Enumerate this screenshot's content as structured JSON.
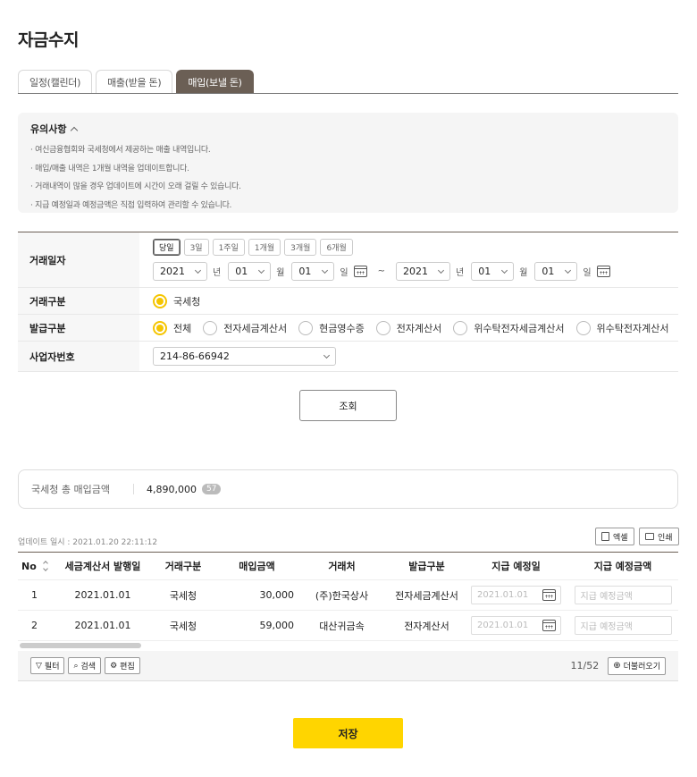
{
  "page_title": "자금수지",
  "tabs": [
    {
      "label": "일정(캘린더)"
    },
    {
      "label": "매출(받을 돈)"
    },
    {
      "label": "매입(보낼 돈)",
      "active": true
    }
  ],
  "notice": {
    "title": "유의사항",
    "items": [
      "· 여신금융협회와 국세청에서 제공하는 매출 내역입니다.",
      "· 매입/매출 내역은 1개월 내역을 업데이트합니다.",
      "· 거래내역이 많을 경우 업데이트에 시간이 오래 걸릴 수 있습니다.",
      "· 지급 예정일과 예정금액은 직접 입력하여 관리할 수 있습니다."
    ]
  },
  "form": {
    "date": {
      "label": "거래일자",
      "quick": [
        "당일",
        "3일",
        "1주일",
        "1개월",
        "3개월",
        "6개월"
      ],
      "start": {
        "year": "2021",
        "month": "01",
        "day": "01"
      },
      "end": {
        "year": "2021",
        "month": "01",
        "day": "01"
      },
      "unit_year": "년",
      "unit_month": "월",
      "unit_day": "일",
      "tilde": "~"
    },
    "type": {
      "label": "거래구분",
      "option": "국세청"
    },
    "issue": {
      "label": "발급구분",
      "options": [
        "전체",
        "전자세금계산서",
        "현금영수증",
        "전자계산서",
        "위수탁전자세금계산서",
        "위수탁전자계산서"
      ]
    },
    "bizno": {
      "label": "사업자번호",
      "value": "214-86-66942"
    },
    "search_label": "조회"
  },
  "summary": {
    "label": "국세청 총 매입금액",
    "amount": "4,890,000",
    "count": "57"
  },
  "updated": "업데이트 일시 : 2021.01.20 22:11:12",
  "actions": {
    "excel": "엑셀",
    "print": "인쇄"
  },
  "table": {
    "headers": [
      "No",
      "세금계산서 발행일",
      "거래구분",
      "매입금액",
      "거래처",
      "발급구분",
      "지급 예정일",
      "지급 예정금액"
    ],
    "rows": [
      {
        "no": "1",
        "date": "2021.01.01",
        "type": "국세청",
        "amount": "30,000",
        "vendor": "(주)한국상사",
        "issue": "전자세금계산서",
        "pay_date": "2021.01.01",
        "pay_amount_ph": "지급 예정금액"
      },
      {
        "no": "2",
        "date": "2021.01.01",
        "type": "국세청",
        "amount": "59,000",
        "vendor": "대산귀금속",
        "issue": "전자계산서",
        "pay_date": "2021.01.01",
        "pay_amount_ph": "지급 예정금액"
      }
    ]
  },
  "footer": {
    "filter": "필터",
    "search": "검색",
    "edit": "편집",
    "page": "11/52",
    "more": "더불러오기"
  },
  "save_label": "저장",
  "colors": {
    "accent": "#ffd500",
    "tab_active": "#6b5f55",
    "radio": "#f5c500"
  }
}
